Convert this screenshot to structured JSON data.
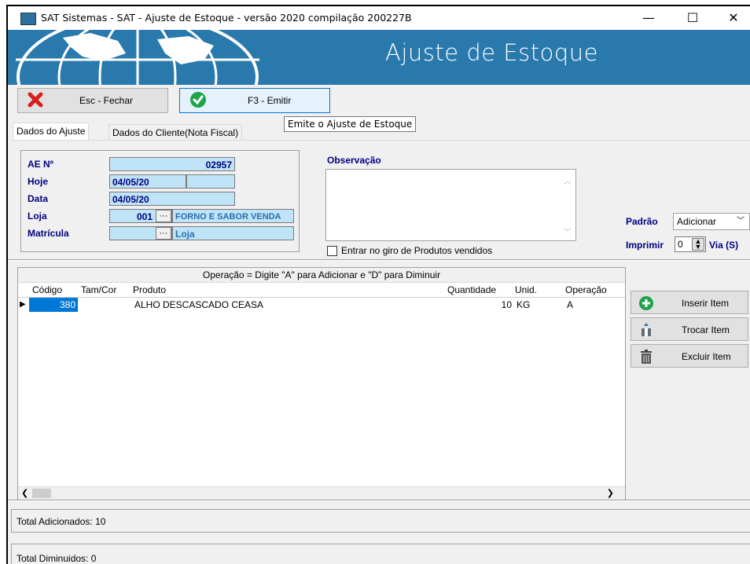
{
  "window": {
    "title": "SAT Sistemas - SAT - Ajuste de Estoque - versão 2020 compilação 200227B",
    "minimize": "—",
    "maximize": "☐",
    "close": "✕"
  },
  "banner": {
    "title": "Ajuste de Estoque"
  },
  "toolbar": {
    "close_label": "Esc - Fechar",
    "emit_label": "F3 - Emitir",
    "tooltip": "Emite o Ajuste de Estoque"
  },
  "tabs": [
    {
      "label": "Dados do Ajuste"
    },
    {
      "label": "Dados do Cliente(Nota Fiscal)"
    }
  ],
  "form": {
    "ae_label": "AE Nº",
    "ae_value": "02957",
    "hoje_label": "Hoje",
    "hoje_value": "04/05/20",
    "data_label": "Data",
    "data_value": "04/05/20",
    "loja_label": "Loja",
    "loja_code": "001",
    "loja_name": "FORNO E SABOR VENDA",
    "matricula_label": "Matrícula",
    "matricula_value": "Loja",
    "dots": "···",
    "observacao_label": "Observação",
    "giro_label": "Entrar no giro de Produtos vendidos",
    "padrao_label": "Padrão",
    "padrao_value": "Adicionar",
    "imprimir_label": "Imprimir",
    "imprimir_value": "0",
    "via_label": "Via (S)"
  },
  "grid": {
    "caption": "Operação = Digite \"A\" para Adicionar e \"D\" para Diminuir",
    "headers": [
      "Código",
      "Tam/Cor",
      "Produto",
      "Quantidade",
      "Unid.",
      "Operação"
    ],
    "rows": [
      {
        "codigo": "380",
        "tamcor": "",
        "produto": "ALHO DESCASCADO CEASA",
        "quantidade": "10",
        "unid": "KG",
        "operacao": "A"
      }
    ]
  },
  "side_buttons": {
    "insert": "Inserir Item",
    "swap": "Trocar Item",
    "delete": "Excluir Item"
  },
  "totals": {
    "added": "Total Adicionados: 10",
    "removed": "Total Diminuidos: 0"
  },
  "colors": {
    "banner": "#2a79ad",
    "label": "#000080",
    "field": "#bfe3f7",
    "selection": "#0078d7"
  }
}
